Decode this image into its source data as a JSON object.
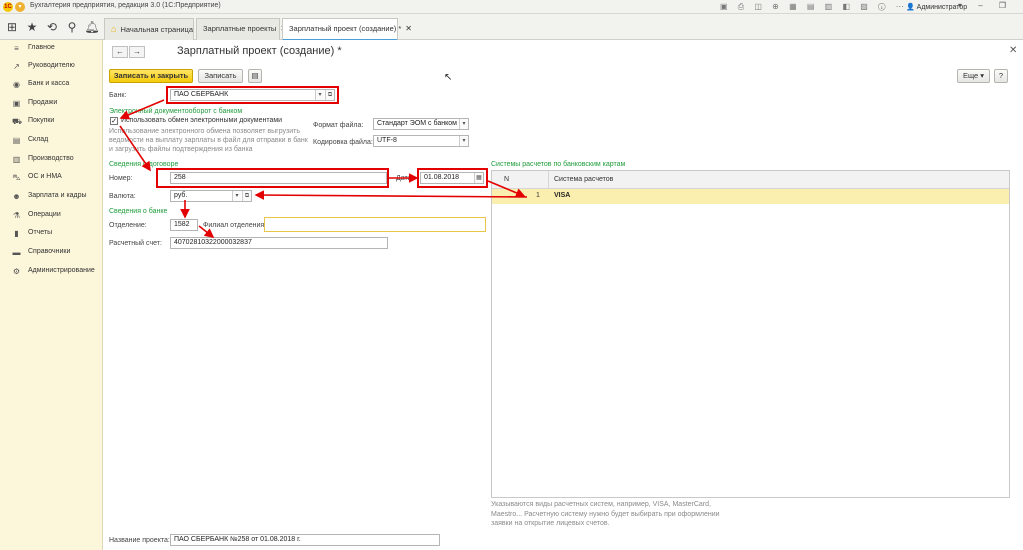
{
  "window": {
    "title": "Бухгалтерия предприятия, редакция 3.0  (1С:Предприятие)",
    "logo_text": "1С",
    "user": "Администратор"
  },
  "tabs": [
    {
      "label": "Начальная страница"
    },
    {
      "label": "Зарплатные проекты"
    },
    {
      "label": "Зарплатный проект (создание) *"
    }
  ],
  "sidebar": {
    "items": [
      {
        "label": "Главное",
        "icon": "menu-icon"
      },
      {
        "label": "Руководителю",
        "icon": "trend-icon"
      },
      {
        "label": "Банк и касса",
        "icon": "bank-icon"
      },
      {
        "label": "Продажи",
        "icon": "sales-icon"
      },
      {
        "label": "Покупки",
        "icon": "cart-icon"
      },
      {
        "label": "Склад",
        "icon": "warehouse-icon"
      },
      {
        "label": "Производство",
        "icon": "production-icon"
      },
      {
        "label": "ОС и НМА",
        "icon": "assets-icon"
      },
      {
        "label": "Зарплата и кадры",
        "icon": "people-icon"
      },
      {
        "label": "Операции",
        "icon": "operations-icon"
      },
      {
        "label": "Отчеты",
        "icon": "reports-icon"
      },
      {
        "label": "Справочники",
        "icon": "book-icon"
      },
      {
        "label": "Администрирование",
        "icon": "gear-icon"
      }
    ]
  },
  "form": {
    "title": "Зарплатный проект (создание) *",
    "save_close_label": "Записать и закрыть",
    "save_label": "Записать",
    "more_label": "Еще",
    "bank_label": "Банк:",
    "bank_value": "ПАО СБЕРБАНК",
    "edo_section": "Электронный документооборот с банком",
    "use_edo_label": "Использовать обмен электронными документами",
    "use_edo_checked": true,
    "edo_note": "Использование электронного обмена позволяет выгрузить ведомости на выплату зарплаты в файл для отправки в банк и загрузить файлы подтверждения из банка",
    "file_format_label": "Формат файла:",
    "file_format_value": "Стандарт ЭОМ с банком (...",
    "encoding_label": "Кодировка файла:",
    "encoding_value": "UTF-8",
    "contract_section": "Сведения о договоре",
    "number_label": "Номер:",
    "number_value": "258",
    "date_label": "Дата:",
    "date_value": "01.08.2018",
    "currency_label": "Валюта:",
    "currency_value": "руб.",
    "bank_info_section": "Сведения о банке",
    "branch_label": "Отделение:",
    "branch_value": "1582",
    "filial_label": "Филиал отделения:",
    "filial_value": "",
    "account_label": "Расчетный счет:",
    "account_value": "40702810322000032837",
    "project_name_label": "Название проекта:",
    "project_name_value": "ПАО СБЕРБАНК №258       от 01.08.2018 г."
  },
  "card_systems": {
    "section_title": "Системы расчетов по банковским картам",
    "columns": [
      "N",
      "Система расчетов"
    ],
    "rows": [
      {
        "n": "1",
        "system": "VISA"
      }
    ],
    "note": "Указываются виды расчетных систем, например, VISA, MasterCard, Maestro... Расчетную систему нужно будет выбирать при оформлении заявки на открытие лицевых счетов."
  },
  "colors": {
    "accent_yellow": "#f5cb0a",
    "sidebar_bg": "#fcf6da",
    "section_green": "#1f9d3c",
    "annotation_red": "#e30000",
    "selected_row": "#fbefb0"
  }
}
